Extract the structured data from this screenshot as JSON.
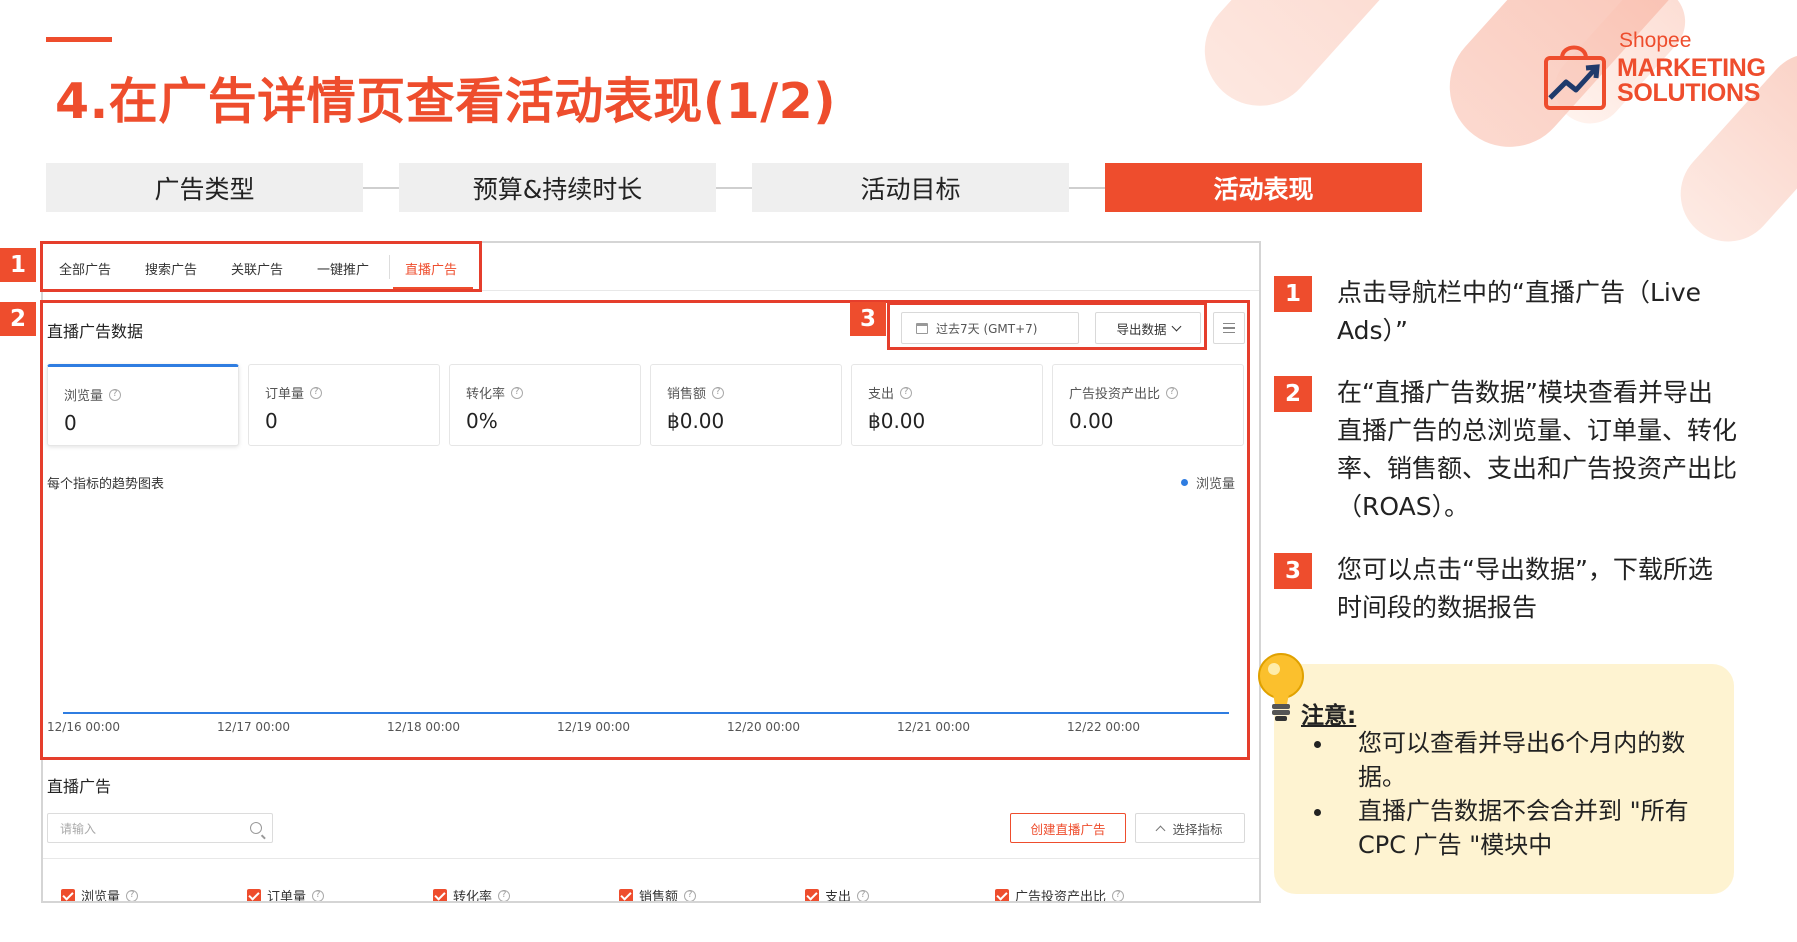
{
  "header": {
    "title": "4.在广告详情页查看活动表现(1/2)",
    "brand_line1": "Shopee",
    "brand_line2": "MARKETING",
    "brand_line3": "SOLUTIONS"
  },
  "steps": [
    {
      "label": "广告类型",
      "active": false
    },
    {
      "label": "预算&持续时长",
      "active": false
    },
    {
      "label": "活动目标",
      "active": false
    },
    {
      "label": "活动表现",
      "active": true
    }
  ],
  "screenshot": {
    "tabs": [
      "全部广告",
      "搜索广告",
      "关联广告",
      "一键推广",
      "直播广告"
    ],
    "active_tab": "直播广告",
    "data_section_title": "直播广告数据",
    "date_range": "过去7天 (GMT+7)",
    "export_label": "导出数据",
    "metrics": [
      {
        "label": "浏览量",
        "value": "0"
      },
      {
        "label": "订单量",
        "value": "0"
      },
      {
        "label": "转化率",
        "value": "0%"
      },
      {
        "label": "销售额",
        "value": "฿0.00"
      },
      {
        "label": "支出",
        "value": "฿0.00"
      },
      {
        "label": "广告投资产出比",
        "value": "0.00"
      }
    ],
    "question_mark": "?",
    "chart_title": "每个指标的趋势图表",
    "legend_label": "浏览量",
    "list_section_title": "直播广告",
    "search_placeholder": "请输入",
    "create_button": "创建直播广告",
    "select_metrics_button": "选择指标",
    "checkbox_metrics": [
      "浏览量",
      "订单量",
      "转化率",
      "销售额",
      "支出",
      "广告投资产出比"
    ]
  },
  "chart_data": {
    "type": "line",
    "title": "每个指标的趋势图表",
    "x": [
      "12/16 00:00",
      "12/17 00:00",
      "12/18 00:00",
      "12/19 00:00",
      "12/20 00:00",
      "12/21 00:00",
      "12/22 00:00"
    ],
    "series": [
      {
        "name": "浏览量",
        "values": [
          0,
          0,
          0,
          0,
          0,
          0,
          0
        ]
      }
    ],
    "legend": "top-right",
    "grid": false,
    "color": "#2f7de1"
  },
  "badges": [
    "1",
    "2",
    "3"
  ],
  "instructions": [
    {
      "num": "1",
      "text": "点击导航栏中的“直播广告（Live Ads）”"
    },
    {
      "num": "2",
      "text": "在“直播广告数据”模块查看并导出直播广告的总浏览量、订单量、转化率、销售额、支出和广告投资产出比（ROAS）。"
    },
    {
      "num": "3",
      "text": "您可以点击“导出数据”，下载所选时间段的数据报告"
    }
  ],
  "note": {
    "title": "注意:",
    "items": [
      "您可以查看并导出6个月内的数据。",
      "直播广告数据不会合并到 \"所有 CPC 广告 \"模块中"
    ]
  },
  "colors": {
    "brand": "#ee4d2d",
    "series": "#2f7de1",
    "note_bg": "#fef3d1",
    "step_bg": "#efefef"
  }
}
